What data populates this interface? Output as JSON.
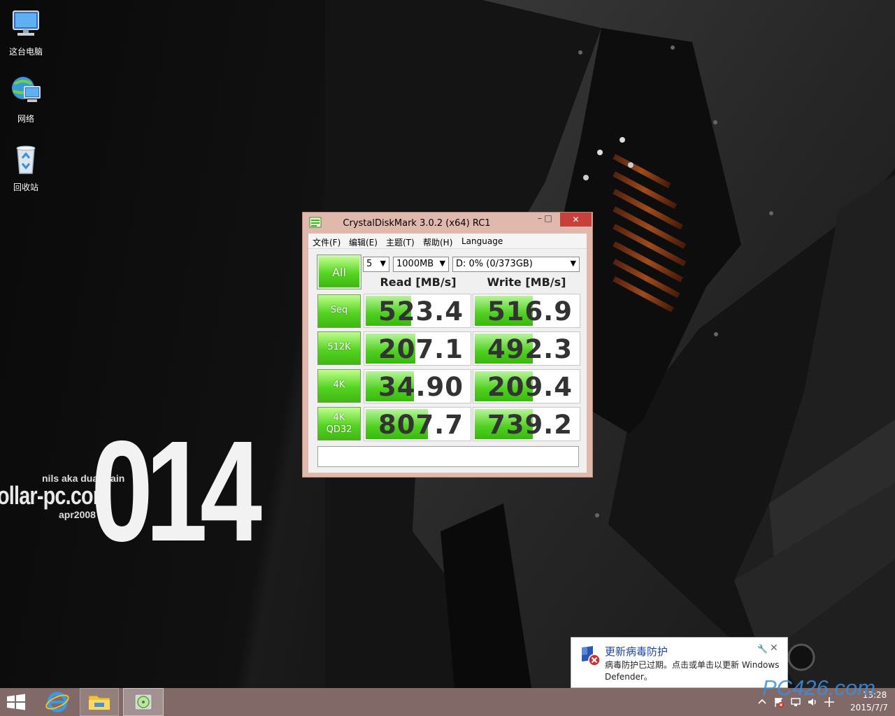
{
  "wallpaper": {
    "big_number": "014",
    "author": "nils aka dualbrain",
    "site": "ollar-pc.com",
    "date": "apr2008"
  },
  "desktop_icons": [
    {
      "label": "这台电脑",
      "icon": "computer-icon"
    },
    {
      "label": "网络",
      "icon": "network-icon"
    },
    {
      "label": "回收站",
      "icon": "recycle-bin-icon"
    }
  ],
  "window": {
    "title": "CrystalDiskMark 3.0.2 (x64) RC1",
    "controls": {
      "minimize": "–",
      "maximize": "□",
      "close": "✕"
    },
    "menu": [
      "文件(F)",
      "编辑(E)",
      "主题(T)",
      "帮助(H)",
      "Language"
    ],
    "all_button": "All",
    "runs_select": "5",
    "size_select": "1000MB",
    "drive_select": "D: 0% (0/373GB)",
    "read_header": "Read [MB/s]",
    "write_header": "Write [MB/s]",
    "rows": [
      {
        "label": "Seq",
        "label2": "",
        "read": "523.4",
        "write": "516.9",
        "read_fill": 0.43,
        "write_fill": 0.55
      },
      {
        "label": "512K",
        "label2": "",
        "read": "207.1",
        "write": "492.3",
        "read_fill": 0.47,
        "write_fill": 0.55
      },
      {
        "label": "4K",
        "label2": "",
        "read": "34.90",
        "write": "209.4",
        "read_fill": 0.46,
        "write_fill": 0.55
      },
      {
        "label": "4K",
        "label2": "QD32",
        "read": "807.7",
        "write": "739.2",
        "read_fill": 0.59,
        "write_fill": 0.55
      }
    ],
    "comment": ""
  },
  "notification": {
    "title": "更新病毒防护",
    "body": "病毒防护已过期。点击或单击以更新 Windows Defender。",
    "pin": "🔧",
    "close": "✕"
  },
  "taskbar": {
    "clock_time": "13:28",
    "clock_date": "2015/7/7",
    "watermark": "PC426.com"
  },
  "colors": {
    "window_frame": "#e0b8ac",
    "close_button": "#c7403a",
    "bar_green": "#4fcf20",
    "taskbar": "#816968",
    "toast_title": "#1c46a6"
  }
}
